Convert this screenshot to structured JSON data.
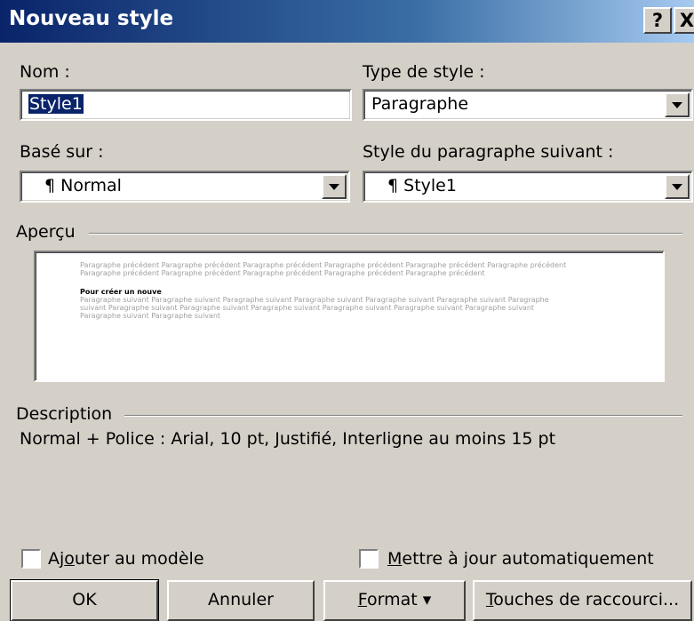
{
  "window": {
    "title": "Nouveau style",
    "help_label": "?",
    "close_label": "X"
  },
  "nom": {
    "label": "Nom :",
    "value": "Style1"
  },
  "type": {
    "label": "Type de style :",
    "value": "Paragraphe"
  },
  "base": {
    "label": "Basé sur :",
    "value": "¶ Normal"
  },
  "suivant": {
    "label": "Style du paragraphe suivant :",
    "value": "¶ Style1"
  },
  "apercu": {
    "label": "Aperçu",
    "prev_line1": "Paragraphe précédent Paragraphe précédent Paragraphe précédent Paragraphe précédent Paragraphe précédent Paragraphe précédent",
    "prev_line2": "Paragraphe précédent Paragraphe précédent Paragraphe précédent Paragraphe précédent Paragraphe précédent",
    "current": "Pour créer un nouve",
    "next_line1": "Paragraphe suivant Paragraphe suivant Paragraphe suivant Paragraphe suivant Paragraphe suivant Paragraphe suivant Paragraphe",
    "next_line2": "suivant Paragraphe suivant Paragraphe suivant Paragraphe suivant Paragraphe suivant Paragraphe suivant Paragraphe suivant",
    "next_line3": "Paragraphe suivant Paragraphe suivant"
  },
  "description": {
    "label": "Description",
    "text": "Normal + Police : Arial, 10 pt, Justifié, Interligne au moins 15 pt"
  },
  "checkboxes": {
    "ajouter": {
      "pre": "Aj",
      "key": "o",
      "post": "uter au modèle",
      "checked": false
    },
    "mettre": {
      "pre": "",
      "key": "M",
      "post": "ettre à jour automatiquement",
      "checked": false
    }
  },
  "buttons": {
    "ok": "OK",
    "annuler": "Annuler",
    "format_key": "F",
    "format_rest": "ormat",
    "format_arrow": "▾",
    "touches_key": "T",
    "touches_rest": "ouches de raccourci..."
  },
  "colors": {
    "face": "#d4d0c8",
    "titlebar_start": "#0a246a",
    "titlebar_end": "#a6caf0",
    "selection": "#0a246a"
  }
}
